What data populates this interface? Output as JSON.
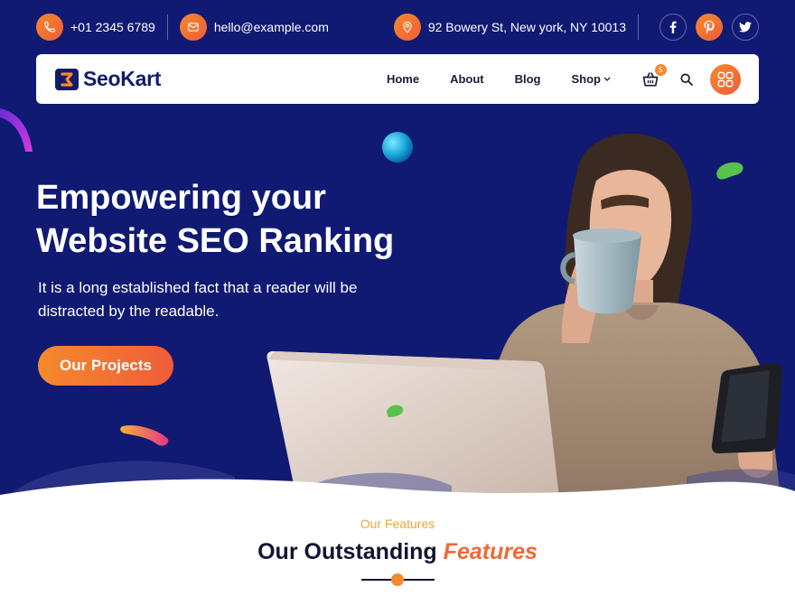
{
  "topbar": {
    "phone": "+01 2345 6789",
    "email": "hello@example.com",
    "address": "92 Bowery St, New york, NY 10013",
    "social": [
      "facebook-icon",
      "pinterest-icon",
      "twitter-icon"
    ]
  },
  "brand": {
    "name": "SeoKart"
  },
  "nav": {
    "items": [
      {
        "label": "Home"
      },
      {
        "label": "About"
      },
      {
        "label": "Blog"
      },
      {
        "label": "Shop"
      }
    ],
    "cart_count": "5"
  },
  "hero": {
    "title_line1": "Empowering your",
    "title_line2": "Website SEO Ranking",
    "text": "It is a long established fact that a reader will be distracted by the readable.",
    "cta": "Our Projects"
  },
  "features": {
    "subtitle": "Our Features",
    "title_main": "Our Outstanding",
    "title_accent": "Features"
  },
  "colors": {
    "hero_bg": "#101a73",
    "accent": "#f58a2c",
    "accent_dark": "#f05c3a",
    "heading": "#101530"
  }
}
